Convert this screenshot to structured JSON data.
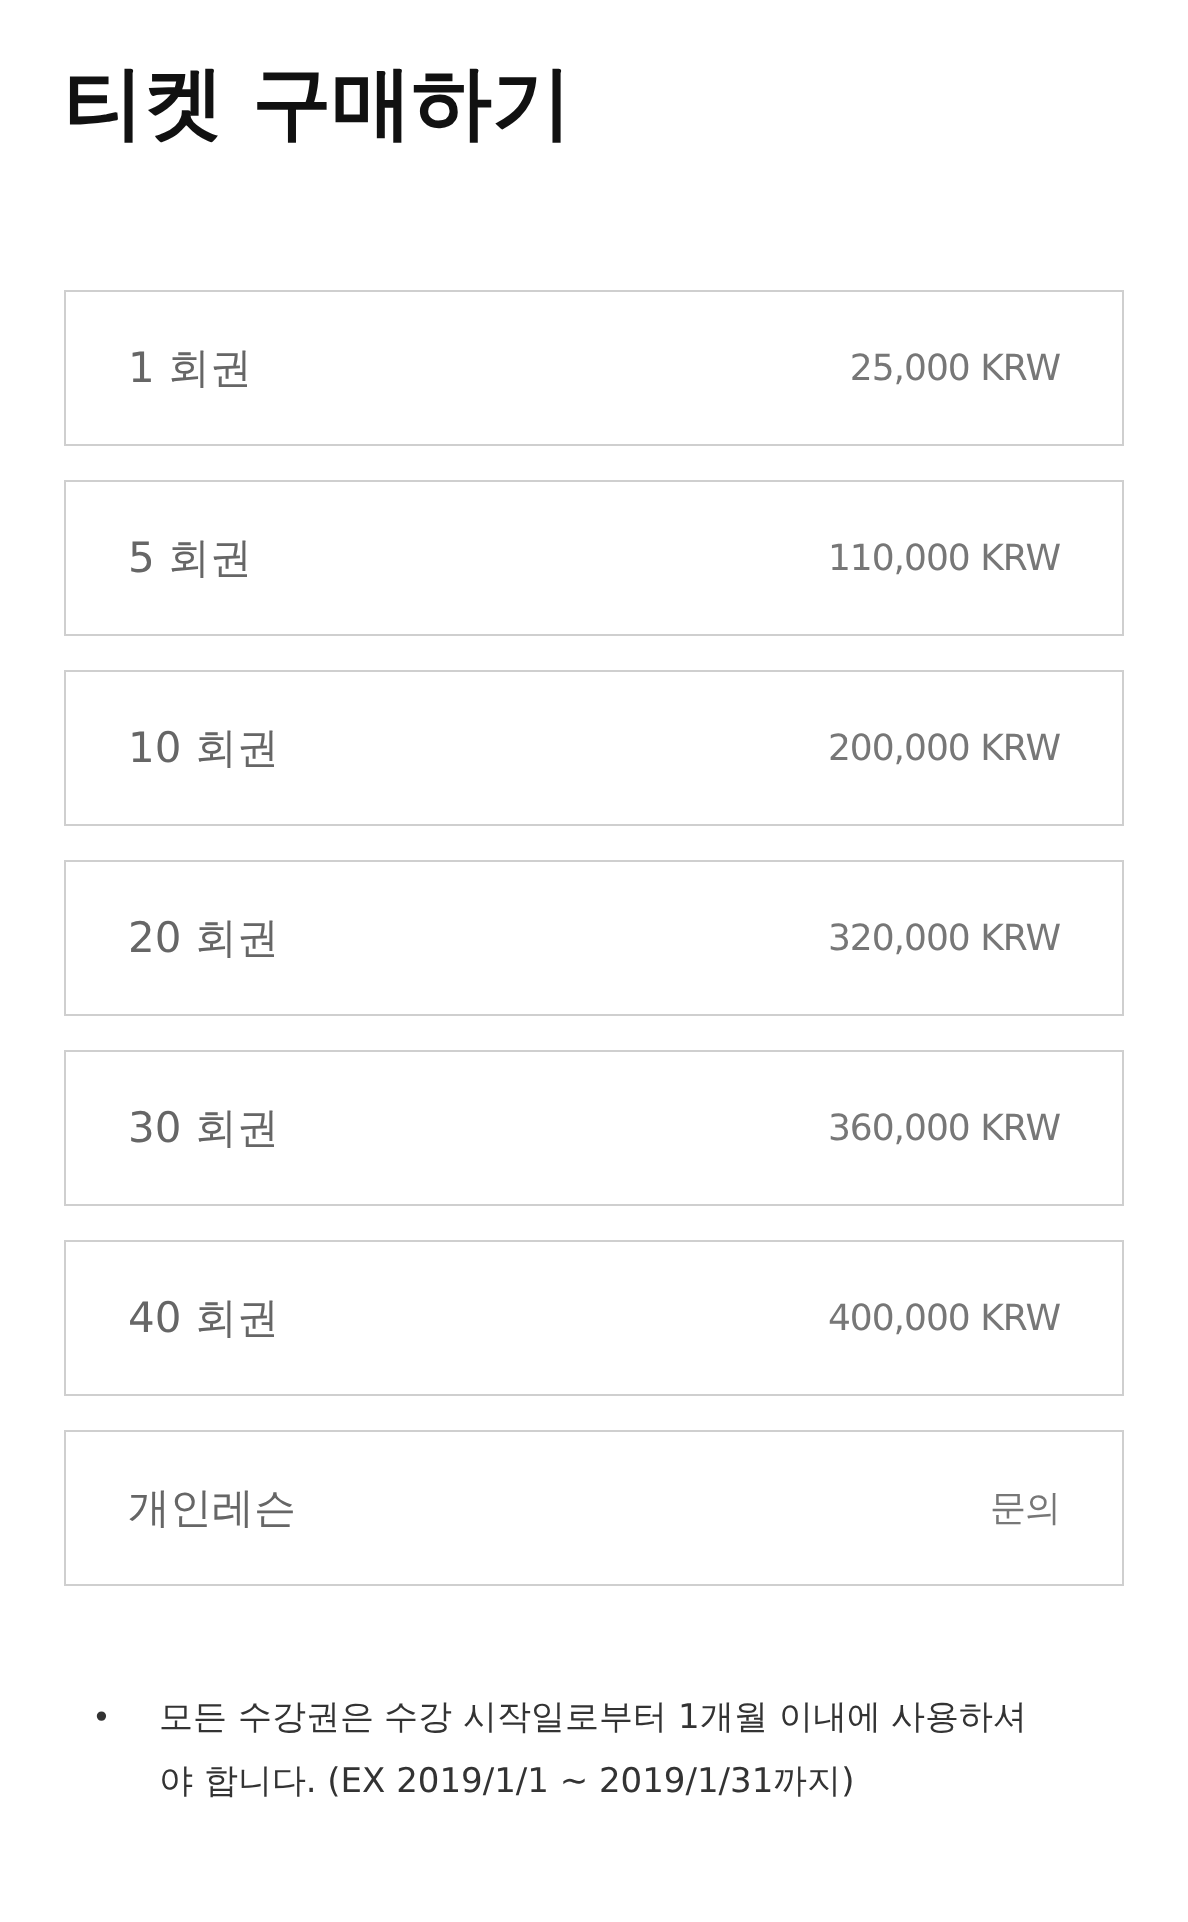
{
  "title": "티켓 구매하기",
  "tickets": [
    {
      "name": "1 회권",
      "price": "25,000 KRW"
    },
    {
      "name": "5 회권",
      "price": "110,000 KRW"
    },
    {
      "name": "10 회권",
      "price": "200,000 KRW"
    },
    {
      "name": "20 회권",
      "price": "320,000 KRW"
    },
    {
      "name": "30 회권",
      "price": "360,000 KRW"
    },
    {
      "name": "40 회권",
      "price": "400,000 KRW"
    },
    {
      "name": "개인레슨",
      "price": "문의"
    }
  ],
  "notes": [
    {
      "bullet": "•",
      "text": "모든 수강권은 수강 시작일로부터 1개월 이내에 사용하셔야 합니다. (EX 2019/1/1 ~ 2019/1/31까지)"
    }
  ]
}
